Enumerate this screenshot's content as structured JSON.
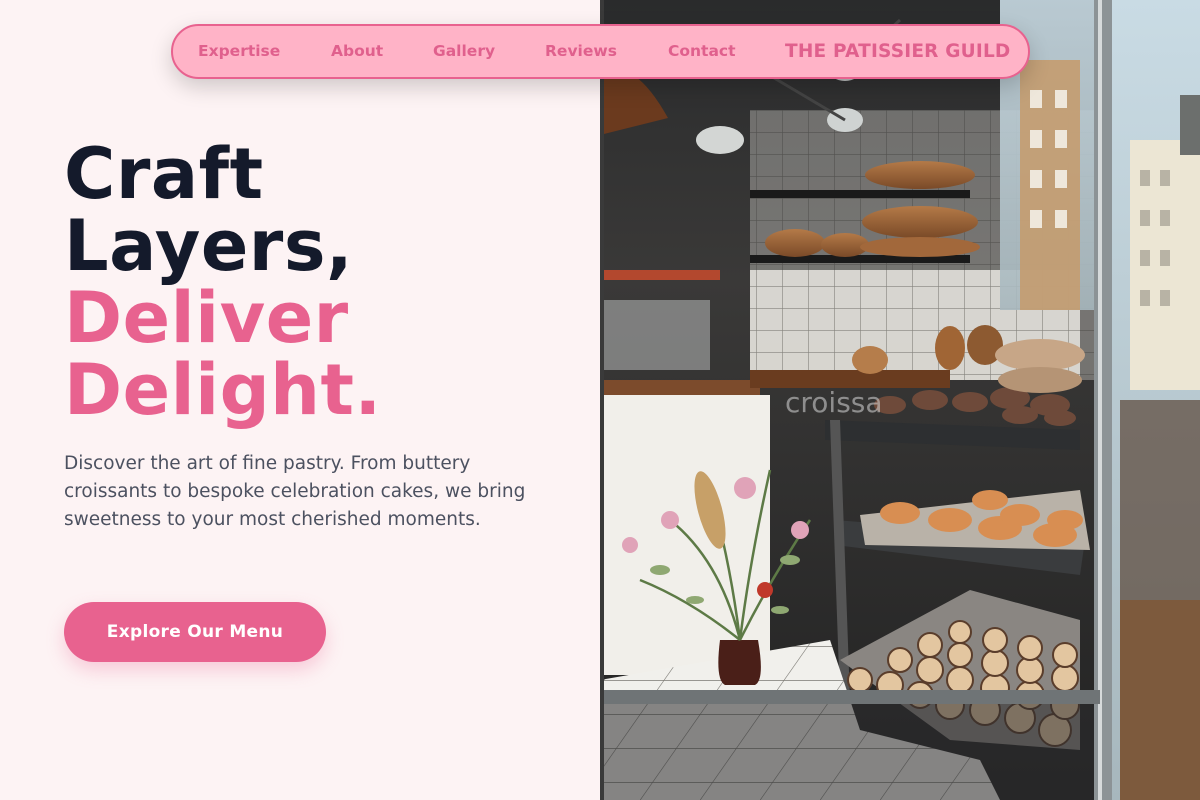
{
  "nav": {
    "links": [
      "Expertise",
      "About",
      "Gallery",
      "Reviews",
      "Contact"
    ],
    "brand": "THE PATISSIER GUILD"
  },
  "hero": {
    "title_line1": "Craft",
    "title_line2": "Layers,",
    "title_line3": "Deliver",
    "title_line4": "Delight.",
    "description": "Discover the art of fine pastry. From buttery croissants to bespoke celebration cakes, we bring sweetness to your most cherished moments.",
    "cta_label": "Explore Our Menu"
  },
  "photo": {
    "window_lettering": "croissa"
  },
  "colors": {
    "accent": "#e8628f",
    "nav_bg": "#ffb3c7",
    "heading_dark": "#141a2b",
    "page_bg": "#fdf3f4"
  }
}
